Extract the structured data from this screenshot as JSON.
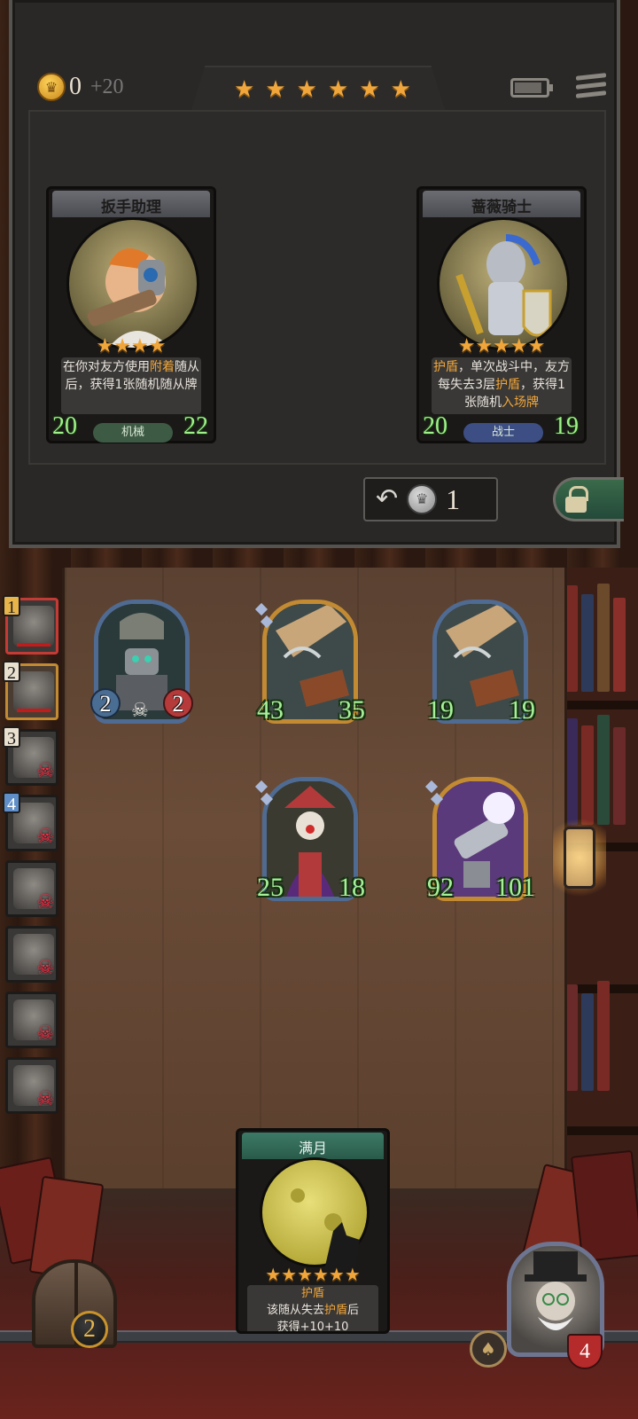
{
  "header": {
    "gold": "0",
    "gold_income": "+20",
    "tier_stars": 6
  },
  "shop": {
    "cards": [
      {
        "name": "扳手助理",
        "stars": 4,
        "desc_parts": [
          "在你对友方使用",
          "附着",
          "随从后，获得1张随机随从牌"
        ],
        "attack": "20",
        "health": "22",
        "tribe": "机械",
        "tribe_color": "#3d5a44"
      },
      {
        "name": "蔷薇骑士",
        "stars": 5,
        "desc_parts": [
          "护盾",
          "，单次战斗中，友方每失去3层",
          "护盾",
          "，获得1张随机",
          "入场牌"
        ],
        "attack": "20",
        "health": "19",
        "tribe": "战士",
        "tribe_color": "#3d4e84"
      }
    ],
    "refresh_cost": "1"
  },
  "board": {
    "minions": [
      {
        "attack": "2",
        "health": "2",
        "frame": "blue",
        "icon": "skull-icon",
        "style": "badge"
      },
      {
        "attack": "43",
        "health": "35",
        "frame": "gold",
        "icon": "",
        "style": "plain"
      },
      {
        "attack": "19",
        "health": "19",
        "frame": "blue",
        "icon": "",
        "style": "plain"
      },
      {
        "attack": "25",
        "health": "18",
        "frame": "blue",
        "icon": "",
        "style": "plain"
      },
      {
        "attack": "92",
        "health": "101",
        "frame": "gold",
        "icon": "",
        "style": "plain"
      }
    ]
  },
  "opponents": [
    {
      "rank": "1",
      "status": "alive"
    },
    {
      "rank": "2",
      "status": "self"
    },
    {
      "rank": "3",
      "status": "dead"
    },
    {
      "rank": "4",
      "status": "dead"
    },
    {
      "rank": "",
      "status": "dead"
    },
    {
      "rank": "",
      "status": "dead"
    },
    {
      "rank": "",
      "status": "dead"
    },
    {
      "rank": "",
      "status": "dead"
    }
  ],
  "hand": {
    "spell_name": "满月",
    "stars": 6,
    "desc_line1": "护盾",
    "desc_line2_parts": [
      "该随从失去",
      "护盾",
      "后"
    ],
    "desc_line3": "获得+10+10"
  },
  "player": {
    "tavern_level": "2",
    "health": "4"
  },
  "colors": {
    "accent_gold": "#f0a63a",
    "stat_green": "#a7f09a",
    "danger_red": "#ff2c45"
  }
}
